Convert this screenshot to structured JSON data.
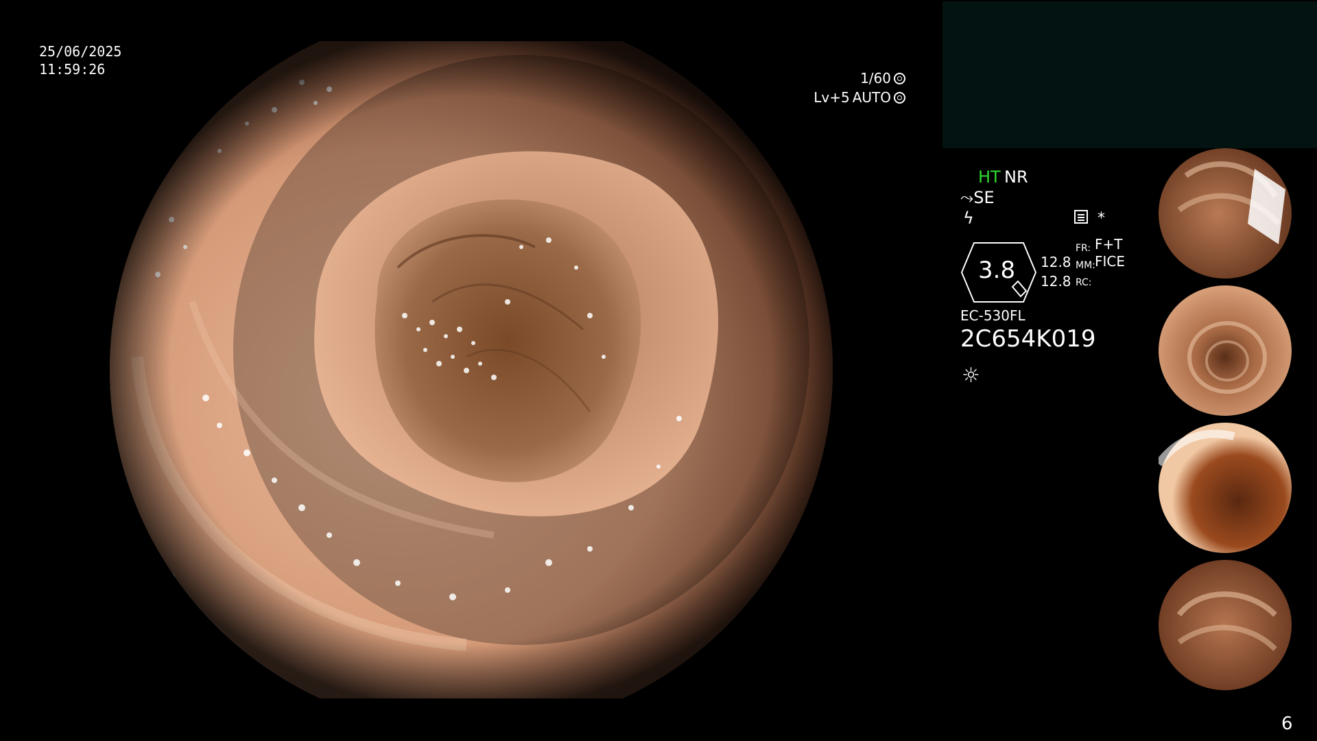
{
  "overlay": {
    "date": "25/06/2025",
    "time": "11:59:26",
    "shutter": "1/60",
    "level": "Lv+5",
    "mode": "AUTO"
  },
  "status": {
    "ht": "HT",
    "nr": "NR",
    "se": "SE",
    "flash_icon": "flash-icon",
    "star": "*",
    "zoom": "3.8",
    "val1": "12.8",
    "val2": "12.8",
    "fr_label": "FR:",
    "fr_value": "F+T",
    "mm_label": "MM:",
    "mm_value": "FICE",
    "rc_label": "RC:",
    "model": "EC-530FL",
    "serial": "2C654K019",
    "light_icon": "sun-icon"
  },
  "thumbnails": [
    {
      "label": "thumbnail-1"
    },
    {
      "label": "thumbnail-2"
    },
    {
      "label": "thumbnail-3"
    },
    {
      "label": "thumbnail-4"
    }
  ],
  "page_number": "6",
  "colors": {
    "background": "#000000",
    "teal_panel": "#021312",
    "ht_green": "#2fdc2f",
    "mucosa": "#d69a78"
  }
}
